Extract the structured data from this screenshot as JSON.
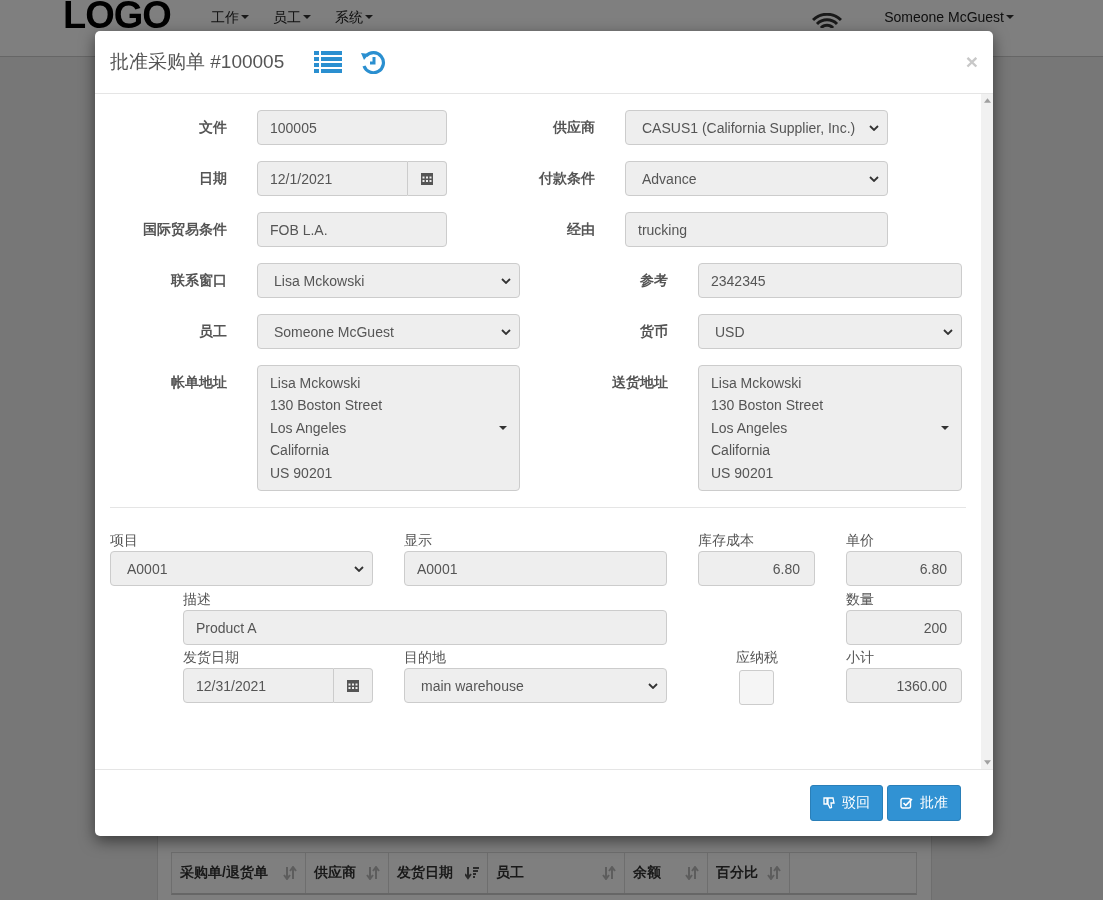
{
  "navbar": {
    "logo": "LOGO",
    "menus": [
      {
        "label": "工作"
      },
      {
        "label": "员工"
      },
      {
        "label": "系统"
      }
    ],
    "user": "Someone McGuest"
  },
  "background_table": {
    "columns": [
      {
        "label": "采购单/退货单",
        "sorted": false
      },
      {
        "label": "供应商",
        "sorted": false
      },
      {
        "label": "发货日期",
        "sorted": true
      },
      {
        "label": "员工",
        "sorted": false
      },
      {
        "label": "余额",
        "sorted": false
      },
      {
        "label": "百分比",
        "sorted": false
      }
    ]
  },
  "modal": {
    "title": "批准采购单 #100005",
    "close": "×",
    "header_rows": [
      {
        "left": {
          "label": "文件",
          "kind": "text",
          "value": "100005"
        },
        "right": {
          "label": "供应商",
          "kind": "select",
          "value": "CASUS1 (California Supplier, Inc.)"
        }
      },
      {
        "left": {
          "label": "日期",
          "kind": "date",
          "value": "12/1/2021"
        },
        "right": {
          "label": "付款条件",
          "kind": "select",
          "value": "Advance"
        }
      },
      {
        "left": {
          "label": "国际贸易条件",
          "kind": "text",
          "value": "FOB L.A."
        },
        "right": {
          "label": "经由",
          "kind": "text",
          "value": "trucking"
        }
      },
      {
        "left": {
          "label": "联系窗口",
          "kind": "select",
          "value": "Lisa Mckowski"
        },
        "right": {
          "label": "参考",
          "kind": "text",
          "value": "2342345"
        }
      },
      {
        "left": {
          "label": "员工",
          "kind": "select",
          "value": "Someone McGuest"
        },
        "right": {
          "label": "货币",
          "kind": "select",
          "value": "USD"
        }
      },
      {
        "left": {
          "label": "帐单地址",
          "kind": "address",
          "lines": [
            "Lisa Mckowski",
            "130 Boston Street",
            "Los Angeles",
            "California",
            "US 90201"
          ]
        },
        "right": {
          "label": "送货地址",
          "kind": "address",
          "lines": [
            "Lisa Mckowski",
            "130 Boston Street",
            "Los Angeles",
            "California",
            "US 90201"
          ]
        }
      }
    ],
    "line_item": [
      {
        "label": "项目",
        "kind": "select",
        "value": "A0001"
      },
      {
        "label": "显示",
        "kind": "text",
        "value": "A0001"
      },
      {
        "label": "库存成本",
        "kind": "number",
        "value": "6.80"
      },
      {
        "label": "单价",
        "kind": "number",
        "value": "6.80"
      },
      {
        "label": "描述",
        "kind": "text",
        "value": "Product A"
      },
      {
        "label": "数量",
        "kind": "number",
        "value": "200"
      },
      {
        "label": "发货日期",
        "kind": "date",
        "value": "12/31/2021"
      },
      {
        "label": "目的地",
        "kind": "select",
        "value": "main warehouse"
      },
      {
        "label": "应纳税",
        "kind": "checkbox",
        "checked": false
      },
      {
        "label": "小计",
        "kind": "number",
        "value": "1360.00"
      }
    ],
    "buttons": [
      {
        "label": "驳回",
        "kind": "reject"
      },
      {
        "label": "批准",
        "kind": "approve"
      }
    ]
  }
}
